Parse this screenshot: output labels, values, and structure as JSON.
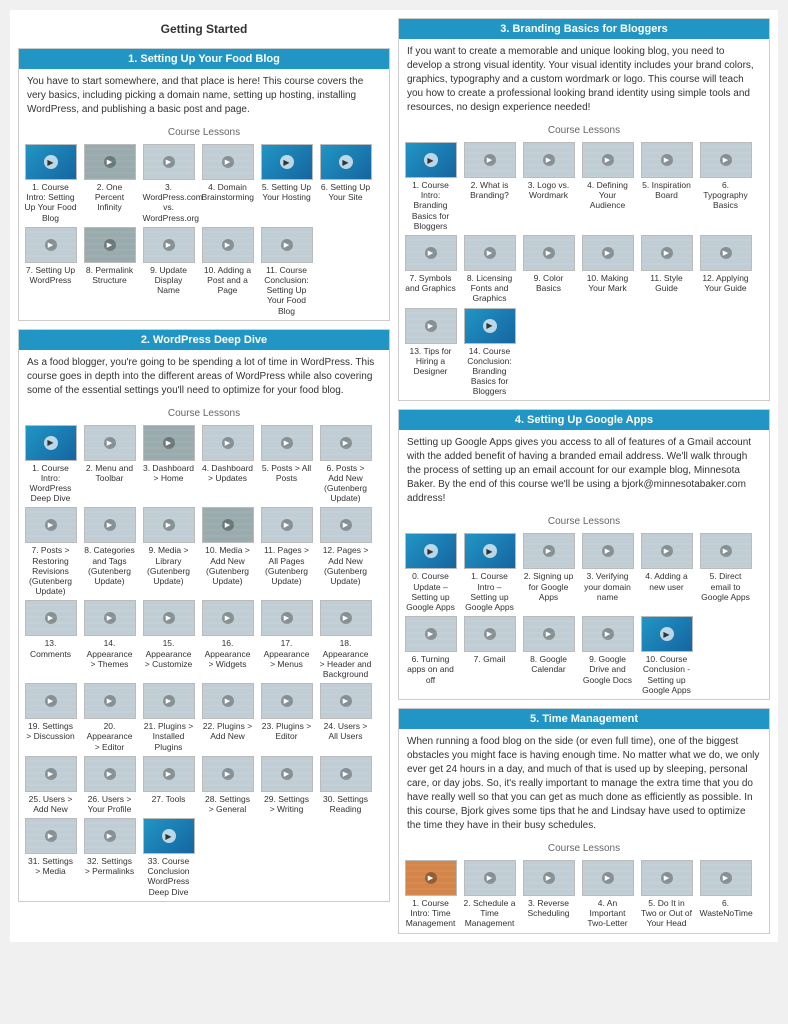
{
  "left_column": {
    "header": "Getting Started",
    "sections": [
      {
        "id": "section1",
        "title": "1. Setting Up Your Food Blog",
        "desc": "You have to start somewhere, and that place is here! This course covers the very basics, including picking a domain name, setting up hosting, installing WordPress, and publishing a basic post and page.",
        "lessons_title": "Course Lessons",
        "lessons": [
          {
            "num": "1.",
            "label": "Course Intro: Setting Up Your Food Blog",
            "color": "thumb-blue"
          },
          {
            "num": "2.",
            "label": "One Percent Infinity",
            "color": "thumb-gray"
          },
          {
            "num": "3.",
            "label": "WordPress.com vs. WordPress.org",
            "color": "thumb-light"
          },
          {
            "num": "4.",
            "label": "Domain Brainstorming",
            "color": "thumb-light"
          },
          {
            "num": "5.",
            "label": "Setting Up Your Hosting",
            "color": "thumb-blue"
          },
          {
            "num": "6.",
            "label": "Setting Up Your Site",
            "color": "thumb-blue"
          },
          {
            "num": "7.",
            "label": "Setting Up WordPress",
            "color": "thumb-light"
          },
          {
            "num": "8.",
            "label": "Permalink Structure",
            "color": "thumb-gray"
          },
          {
            "num": "9.",
            "label": "Update Display Name",
            "color": "thumb-light"
          },
          {
            "num": "10.",
            "label": "Adding a Post and a Page",
            "color": "thumb-light"
          },
          {
            "num": "11.",
            "label": "Course Conclusion: Setting Up Your Food Blog",
            "color": "thumb-light"
          }
        ]
      },
      {
        "id": "section2",
        "title": "2. WordPress Deep Dive",
        "desc": "As a food blogger, you're going to be spending a lot of time in WordPress. This course goes in depth into the different areas of WordPress while also covering some of the essential settings you'll need to optimize for your food blog.",
        "lessons_title": "Course Lessons",
        "lessons": [
          {
            "num": "1.",
            "label": "Course Intro: WordPress Deep Dive",
            "color": "thumb-blue"
          },
          {
            "num": "2.",
            "label": "Menu and Toolbar",
            "color": "thumb-light"
          },
          {
            "num": "3.",
            "label": "Dashboard > Home",
            "color": "thumb-gray"
          },
          {
            "num": "4.",
            "label": "Dashboard > Updates",
            "color": "thumb-light"
          },
          {
            "num": "5.",
            "label": "Posts > All Posts",
            "color": "thumb-light"
          },
          {
            "num": "6.",
            "label": "Posts > Add New (Gutenberg Update)",
            "color": "thumb-light"
          },
          {
            "num": "7.",
            "label": "Posts > Restoring Revisions (Gutenberg Update)",
            "color": "thumb-light"
          },
          {
            "num": "8.",
            "label": "Categories and Tags (Gutenberg Update)",
            "color": "thumb-light"
          },
          {
            "num": "9.",
            "label": "Media > Library (Gutenberg Update)",
            "color": "thumb-light"
          },
          {
            "num": "10.",
            "label": "Media > Add New (Gutenberg Update)",
            "color": "thumb-gray"
          },
          {
            "num": "11.",
            "label": "Pages > All Pages (Gutenberg Update)",
            "color": "thumb-light"
          },
          {
            "num": "12.",
            "label": "Pages > Add New (Gutenberg Update)",
            "color": "thumb-light"
          },
          {
            "num": "13.",
            "label": "Comments",
            "color": "thumb-light"
          },
          {
            "num": "14.",
            "label": "Appearance > Themes",
            "color": "thumb-light"
          },
          {
            "num": "15.",
            "label": "Appearance > Customize",
            "color": "thumb-light"
          },
          {
            "num": "16.",
            "label": "Appearance > Widgets",
            "color": "thumb-light"
          },
          {
            "num": "17.",
            "label": "Appearance > Menus",
            "color": "thumb-light"
          },
          {
            "num": "18.",
            "label": "Appearance > Header and Background",
            "color": "thumb-light"
          },
          {
            "num": "19.",
            "label": "Settings > Discussion",
            "color": "thumb-light"
          },
          {
            "num": "20.",
            "label": "Appearance > Editor",
            "color": "thumb-light"
          },
          {
            "num": "21.",
            "label": "Plugins > Installed Plugins",
            "color": "thumb-light"
          },
          {
            "num": "22.",
            "label": "Plugins > Add New",
            "color": "thumb-light"
          },
          {
            "num": "23.",
            "label": "Plugins > Editor",
            "color": "thumb-light"
          },
          {
            "num": "24.",
            "label": "Users > All Users",
            "color": "thumb-light"
          },
          {
            "num": "25.",
            "label": "Users > Add New",
            "color": "thumb-light"
          },
          {
            "num": "26.",
            "label": "Users > Your Profile",
            "color": "thumb-light"
          },
          {
            "num": "27.",
            "label": "Tools",
            "color": "thumb-light"
          },
          {
            "num": "28.",
            "label": "Settings > General",
            "color": "thumb-light"
          },
          {
            "num": "29.",
            "label": "Settings > Writing",
            "color": "thumb-light"
          },
          {
            "num": "30.",
            "label": "Settings Reading",
            "color": "thumb-light"
          },
          {
            "num": "31.",
            "label": "Settings > Media",
            "color": "thumb-light"
          },
          {
            "num": "32.",
            "label": "Settings > Permalinks",
            "color": "thumb-light"
          },
          {
            "num": "33.",
            "label": "Course Conclusion WordPress Deep Dive",
            "color": "thumb-blue"
          }
        ]
      }
    ]
  },
  "right_column": {
    "sections": [
      {
        "id": "section3",
        "title": "3. Branding Basics for Bloggers",
        "desc": "If you want to create a memorable and unique looking blog, you need to develop a strong visual identity. Your visual identity includes your brand colors, graphics, typography and a custom wordmark or logo. This course will teach you how to create a professional looking brand identity using simple tools and resources, no design experience needed!",
        "lessons_title": "Course Lessons",
        "lessons": [
          {
            "num": "1.",
            "label": "Course Intro: Branding Basics for Bloggers",
            "color": "thumb-blue"
          },
          {
            "num": "2.",
            "label": "What is Branding?",
            "color": "thumb-light"
          },
          {
            "num": "3.",
            "label": "Logo vs. Wordmark",
            "color": "thumb-light"
          },
          {
            "num": "4.",
            "label": "Defining Your Audience",
            "color": "thumb-light"
          },
          {
            "num": "5.",
            "label": "Inspiration Board",
            "color": "thumb-light"
          },
          {
            "num": "6.",
            "label": "Typography Basics",
            "color": "thumb-light"
          },
          {
            "num": "7.",
            "label": "Symbols and Graphics",
            "color": "thumb-light"
          },
          {
            "num": "8.",
            "label": "Licensing Fonts and Graphics",
            "color": "thumb-light"
          },
          {
            "num": "9.",
            "label": "Color Basics",
            "color": "thumb-light"
          },
          {
            "num": "10.",
            "label": "Making Your Mark",
            "color": "thumb-light"
          },
          {
            "num": "11.",
            "label": "Style Guide",
            "color": "thumb-light"
          },
          {
            "num": "12.",
            "label": "Applying Your Guide",
            "color": "thumb-light"
          },
          {
            "num": "13.",
            "label": "Tips for Hiring a Designer",
            "color": "thumb-light"
          },
          {
            "num": "14.",
            "label": "Course Conclusion: Branding Basics for Bloggers",
            "color": "thumb-blue"
          }
        ]
      },
      {
        "id": "section4",
        "title": "4. Setting Up Google Apps",
        "desc": "Setting up Google Apps gives you access to all of features of a Gmail account with the added benefit of having a branded email address. We'll walk through the process of setting up an email account for our example blog, Minnesota Baker. By the end of this course we'll be using a bjork@minnesotabaker.com address!",
        "lessons_title": "Course Lessons",
        "lessons": [
          {
            "num": "0.",
            "label": "Course Update – Setting up Google Apps",
            "color": "thumb-blue"
          },
          {
            "num": "1.",
            "label": "Course Intro – Setting up Google Apps",
            "color": "thumb-blue"
          },
          {
            "num": "2.",
            "label": "Signing up for Google Apps",
            "color": "thumb-light"
          },
          {
            "num": "3.",
            "label": "Verifying your domain name",
            "color": "thumb-light"
          },
          {
            "num": "4.",
            "label": "Adding a new user",
            "color": "thumb-light"
          },
          {
            "num": "5.",
            "label": "Direct email to Google Apps",
            "color": "thumb-light"
          },
          {
            "num": "6.",
            "label": "Turning apps on and off",
            "color": "thumb-light"
          },
          {
            "num": "7.",
            "label": "Gmail",
            "color": "thumb-light"
          },
          {
            "num": "8.",
            "label": "Google Calendar",
            "color": "thumb-light"
          },
          {
            "num": "9.",
            "label": "Google Drive and Google Docs",
            "color": "thumb-light"
          },
          {
            "num": "10.",
            "label": "Course Conclusion - Setting up Google Apps",
            "color": "thumb-blue"
          }
        ]
      },
      {
        "id": "section5",
        "title": "5. Time Management",
        "desc": "When running a food blog on the side (or even full time), one of the biggest obstacles you might face is having enough time. No matter what we do, we only ever get 24 hours in a day, and much of that is used up by sleeping, personal care, or day jobs. So, it's really important to manage the extra time that you do have really well so that you can get as much done as efficiently as possible. In this course, Bjork gives some tips that he and Lindsay have used to optimize the time they have in their busy schedules.",
        "lessons_title": "Course Lessons",
        "lessons": [
          {
            "num": "1.",
            "label": "Course Intro: Time Management",
            "color": "thumb-orange"
          },
          {
            "num": "2.",
            "label": "Schedule a Time Management",
            "color": "thumb-light"
          },
          {
            "num": "3.",
            "label": "Reverse Scheduling",
            "color": "thumb-light"
          },
          {
            "num": "4.",
            "label": "An Important Two-Letter",
            "color": "thumb-light"
          },
          {
            "num": "5.",
            "label": "Do It in Two or Out of Your Head",
            "color": "thumb-light"
          },
          {
            "num": "6.",
            "label": "WasteNoTime",
            "color": "thumb-light"
          }
        ]
      }
    ]
  }
}
